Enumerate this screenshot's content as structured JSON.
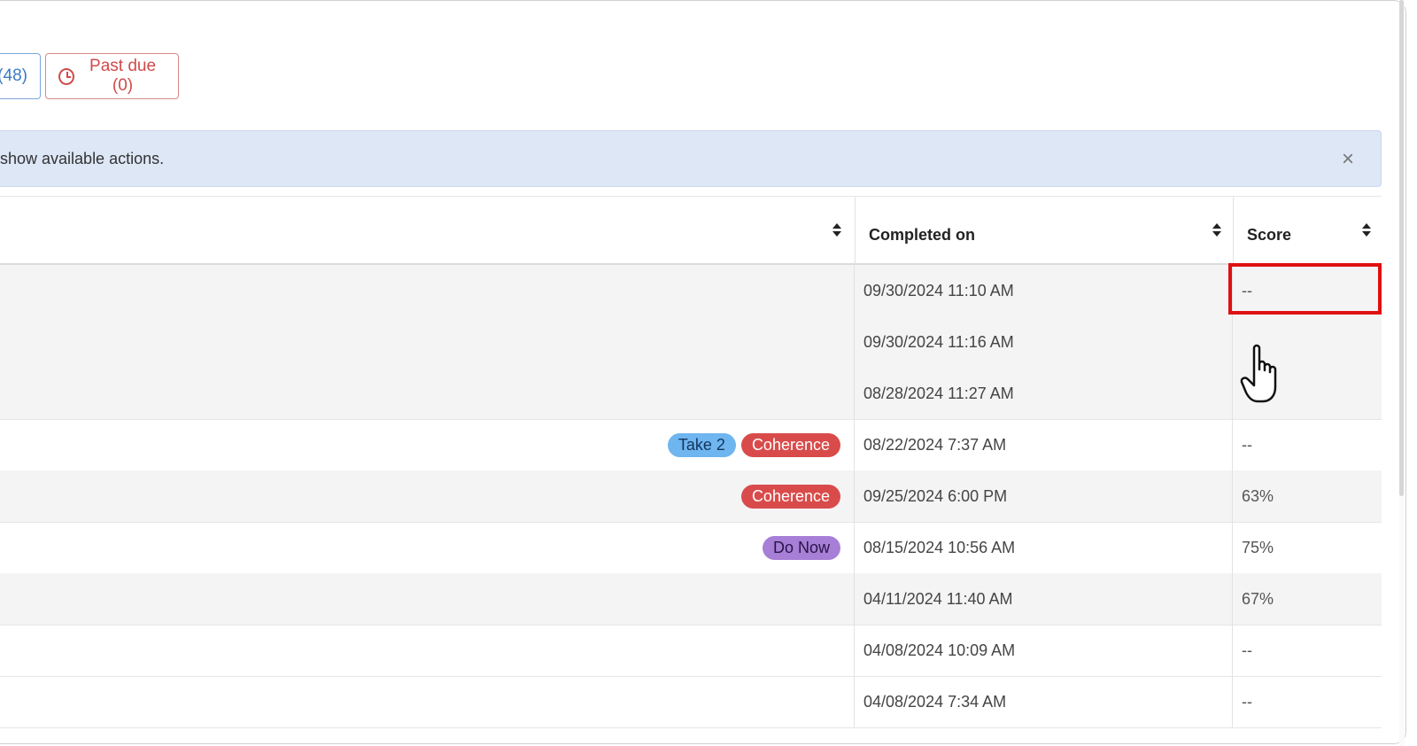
{
  "filters": {
    "all_count": "(48)",
    "past_due": "Past due (0)"
  },
  "info": {
    "text": "show available actions.",
    "close": "×"
  },
  "table": {
    "headers": {
      "completed_on": "Completed on",
      "score": "Score"
    },
    "rows": [
      {
        "badges": [],
        "completed": "09/30/2024 11:10 AM",
        "score": "--"
      },
      {
        "badges": [],
        "completed": "09/30/2024 11:16 AM",
        "score": ""
      },
      {
        "badges": [],
        "completed": "08/28/2024 11:27 AM",
        "score": ""
      },
      {
        "badges": [
          {
            "label": "Take 2",
            "kind": "take2"
          },
          {
            "label": "Coherence",
            "kind": "coherence"
          }
        ],
        "completed": "08/22/2024 7:37 AM",
        "score": "--"
      },
      {
        "badges": [
          {
            "label": "Coherence",
            "kind": "coherence"
          }
        ],
        "completed": "09/25/2024 6:00 PM",
        "score": "63%"
      },
      {
        "badges": [
          {
            "label": "Do Now",
            "kind": "donow"
          }
        ],
        "completed": "08/15/2024 10:56 AM",
        "score": "75%"
      },
      {
        "badges": [],
        "completed": "04/11/2024 11:40 AM",
        "score": "67%"
      },
      {
        "badges": [],
        "completed": "04/08/2024 10:09 AM",
        "score": "--"
      },
      {
        "badges": [],
        "completed": "04/08/2024 7:34 AM",
        "score": "--"
      }
    ]
  },
  "colors": {
    "highlight": "#e01010",
    "info_bar": "#dde7f6",
    "past_due": "#d04a4a"
  },
  "icons": [
    "clock-icon",
    "sort-icon",
    "close-icon",
    "hand-cursor-icon"
  ]
}
